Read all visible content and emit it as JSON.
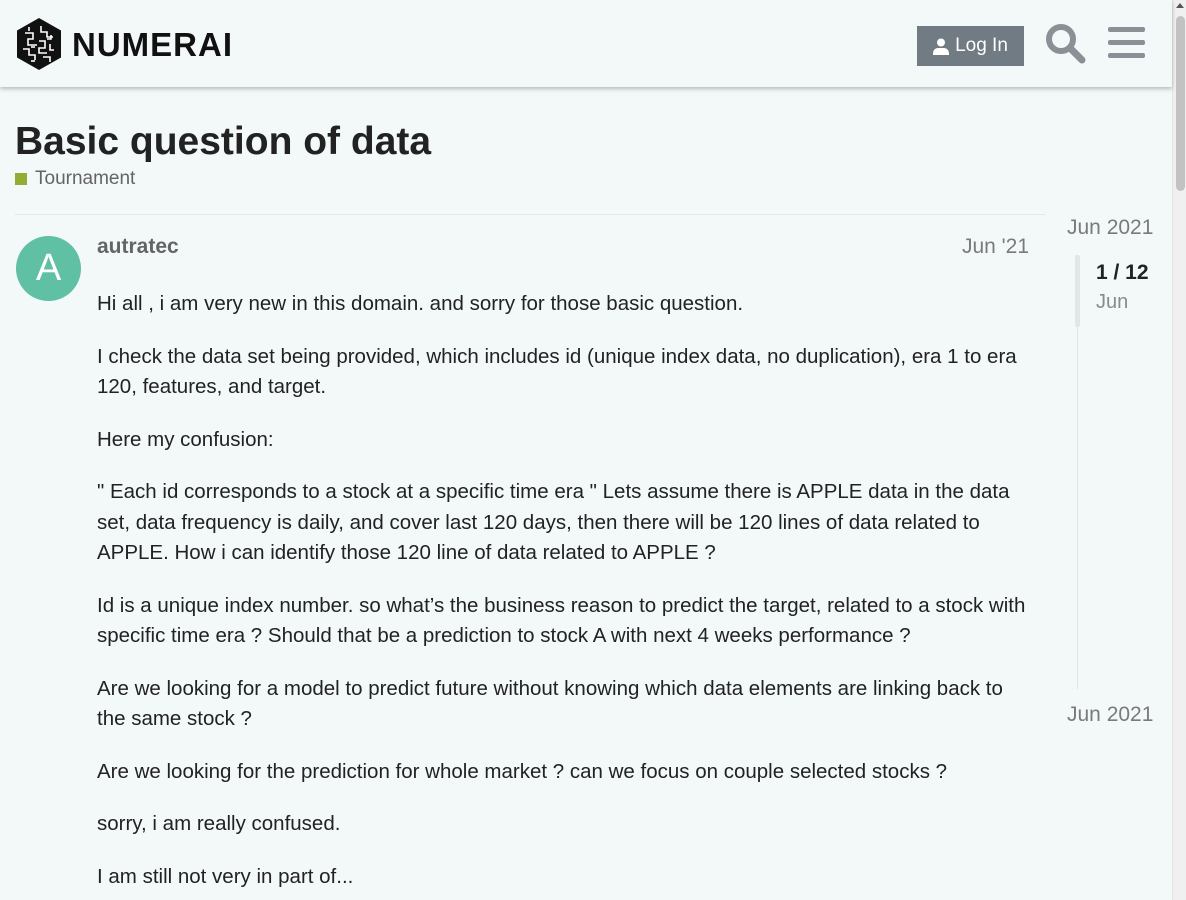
{
  "header": {
    "logo_text": "NUMERAI",
    "login_label": "Log In",
    "search_icon": "search-icon",
    "menu_icon": "hamburger-menu-icon"
  },
  "topic": {
    "title": "Basic question of data",
    "category": "Tournament",
    "category_color": "#92ad35"
  },
  "post": {
    "avatar_letter": "A",
    "avatar_color": "#5fc0a3",
    "username": "autratec",
    "date": "Jun '21",
    "paragraphs": [
      "Hi all , i am very new in this domain. and sorry for those basic question.",
      "I check the data set being provided, which includes id (unique index data, no duplication), era 1 to era 120, features, and target.",
      "Here my confusion:",
      "\" Each id corresponds to a stock at a specific time era \" Lets assume there is APPLE data in the data set, data frequency is daily, and cover last 120 days, then there will be 120 lines of data related to APPLE. How i can identify those 120 line of data related to APPLE ?",
      "Id is a unique index number. so what’s the business reason to predict the target, related to a stock with specific time era ? Should that be a prediction to stock A with next 4 weeks performance ?",
      "Are we looking for a model to predict future without knowing which data elements are linking back to the same stock ?",
      "Are we looking for the prediction for whole market ? can we focus on couple selected stocks ?",
      "sorry, i am really confused.",
      "I am still not very in part of..."
    ]
  },
  "timeline": {
    "start_date": "Jun 2021",
    "progress": "1 / 12",
    "handle_date": "Jun",
    "end_date": "Jun 2021"
  }
}
